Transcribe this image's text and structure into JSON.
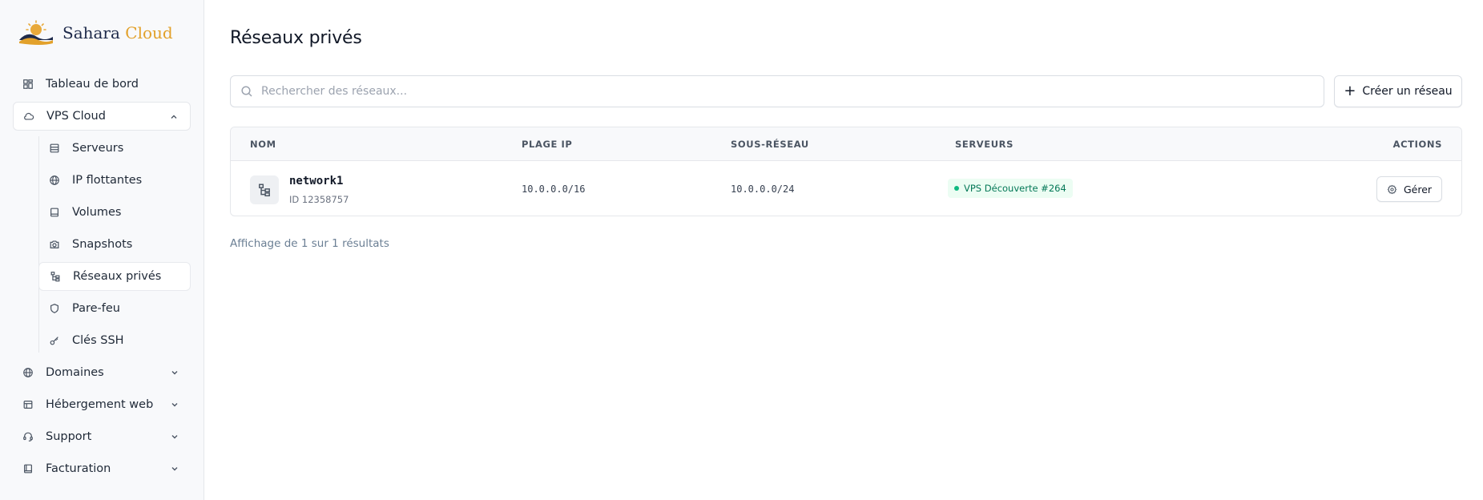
{
  "brand": {
    "name_part1": "Sahara",
    "name_part2": "Cloud",
    "logo_icon": "dunes-sun-logo-icon",
    "colors": {
      "navy": "#1e2a4a",
      "gold": "#e2a12b"
    }
  },
  "sidebar": {
    "items": [
      {
        "label": "Tableau de bord",
        "icon": "dashboard-icon"
      },
      {
        "label": "VPS Cloud",
        "icon": "cloud-icon",
        "expanded": true,
        "children": [
          {
            "label": "Serveurs",
            "icon": "server-icon"
          },
          {
            "label": "IP flottantes",
            "icon": "globe-icon"
          },
          {
            "label": "Volumes",
            "icon": "volume-icon"
          },
          {
            "label": "Snapshots",
            "icon": "camera-icon"
          },
          {
            "label": "Réseaux privés",
            "icon": "network-icon",
            "active": true
          },
          {
            "label": "Pare-feu",
            "icon": "shield-icon"
          },
          {
            "label": "Clés SSH",
            "icon": "key-icon"
          }
        ]
      },
      {
        "label": "Domaines",
        "icon": "globe-icon"
      },
      {
        "label": "Hébergement web",
        "icon": "web-hosting-icon"
      },
      {
        "label": "Support",
        "icon": "headset-icon"
      },
      {
        "label": "Facturation",
        "icon": "billing-icon"
      }
    ]
  },
  "main": {
    "title": "Réseaux privés",
    "search": {
      "placeholder": "Rechercher des réseaux...",
      "value": ""
    },
    "create_button": "Créer un réseau",
    "table": {
      "columns": [
        "NOM",
        "PLAGE IP",
        "SOUS-RÉSEAU",
        "SERVEURS",
        "ACTIONS"
      ],
      "rows": [
        {
          "name": "network1",
          "id": "ID 12358757",
          "ip_range": "10.0.0.0/16",
          "subnet": "10.0.0.0/24",
          "server": "VPS Découverte #264",
          "action": "Gérer"
        }
      ]
    },
    "results_text": "Affichage de 1 sur 1 résultats"
  }
}
